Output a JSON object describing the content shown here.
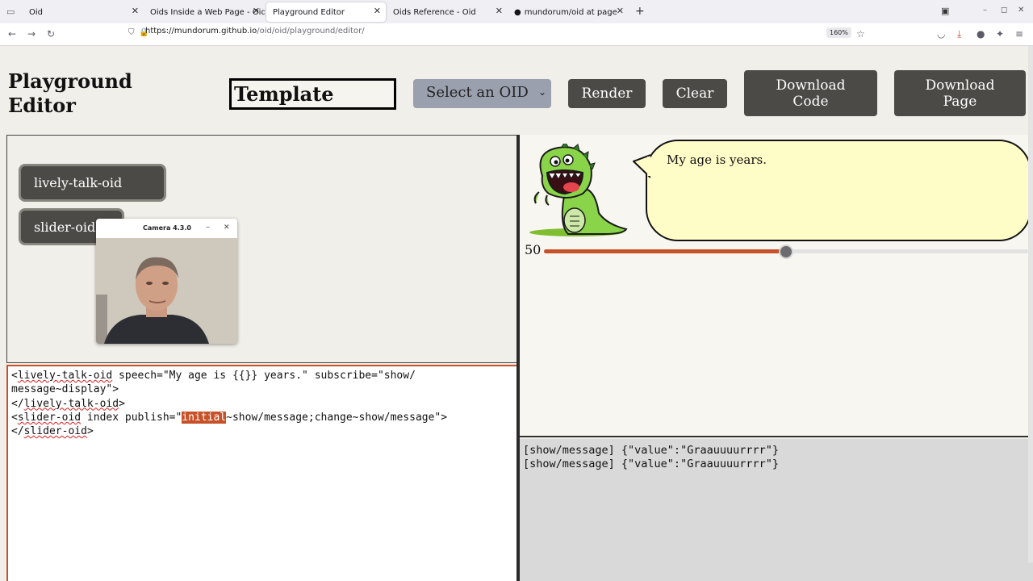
{
  "browser": {
    "tabs": [
      {
        "label": "Oid"
      },
      {
        "label": "Oids Inside a Web Page - Oid"
      },
      {
        "label": "Playground Editor"
      },
      {
        "label": "Oids Reference - Oid"
      },
      {
        "label": "mundorum/oid at page"
      }
    ],
    "url_host": "https://mundorum.github.io",
    "url_path": "/oid/oid/playground/editor/",
    "zoom": "160%"
  },
  "header": {
    "title_line1": "Playground",
    "title_line2": "Editor",
    "template_value": "Template",
    "select_value": "Select an OID",
    "render_label": "Render",
    "clear_label": "Clear",
    "download_code_line1": "Download",
    "download_code_line2": "Code",
    "download_page_line1": "Download",
    "download_page_line2": "Page"
  },
  "palette": {
    "oids": [
      "lively-talk-oid",
      "slider-oid"
    ]
  },
  "camera": {
    "title": "Camera 4.3.0"
  },
  "editor": {
    "l1_lt": "<",
    "l1_tag": "lively-talk-oid",
    "l1_rest": " speech=\"My age is {{}} years.\" subscribe=\"show/",
    "l2": "message~display\">",
    "l3_open": "</",
    "l3_tag": "lively-talk-oid",
    "l3_close": ">",
    "l4_lt": "<",
    "l4_tag": "slider-oid",
    "l4_a": " index publish=\"",
    "l4_hl": "initial",
    "l4_b": "~show/message;change~show/message\">",
    "l5_open": "</",
    "l5_tag": "slider-oid",
    "l5_close": ">"
  },
  "preview": {
    "speech": "My age is years.",
    "slider_value": "50",
    "slider_min": 0,
    "slider_max": 100
  },
  "log": {
    "lines": [
      "[show/message] {\"value\":\"Graauuuurrrr\"}",
      "[show/message] {\"value\":\"Graauuuurrrr\"}"
    ]
  },
  "colors": {
    "accent": "#c7522a",
    "button_bg": "#4b4a46",
    "bubble_bg": "#fffdc7"
  }
}
